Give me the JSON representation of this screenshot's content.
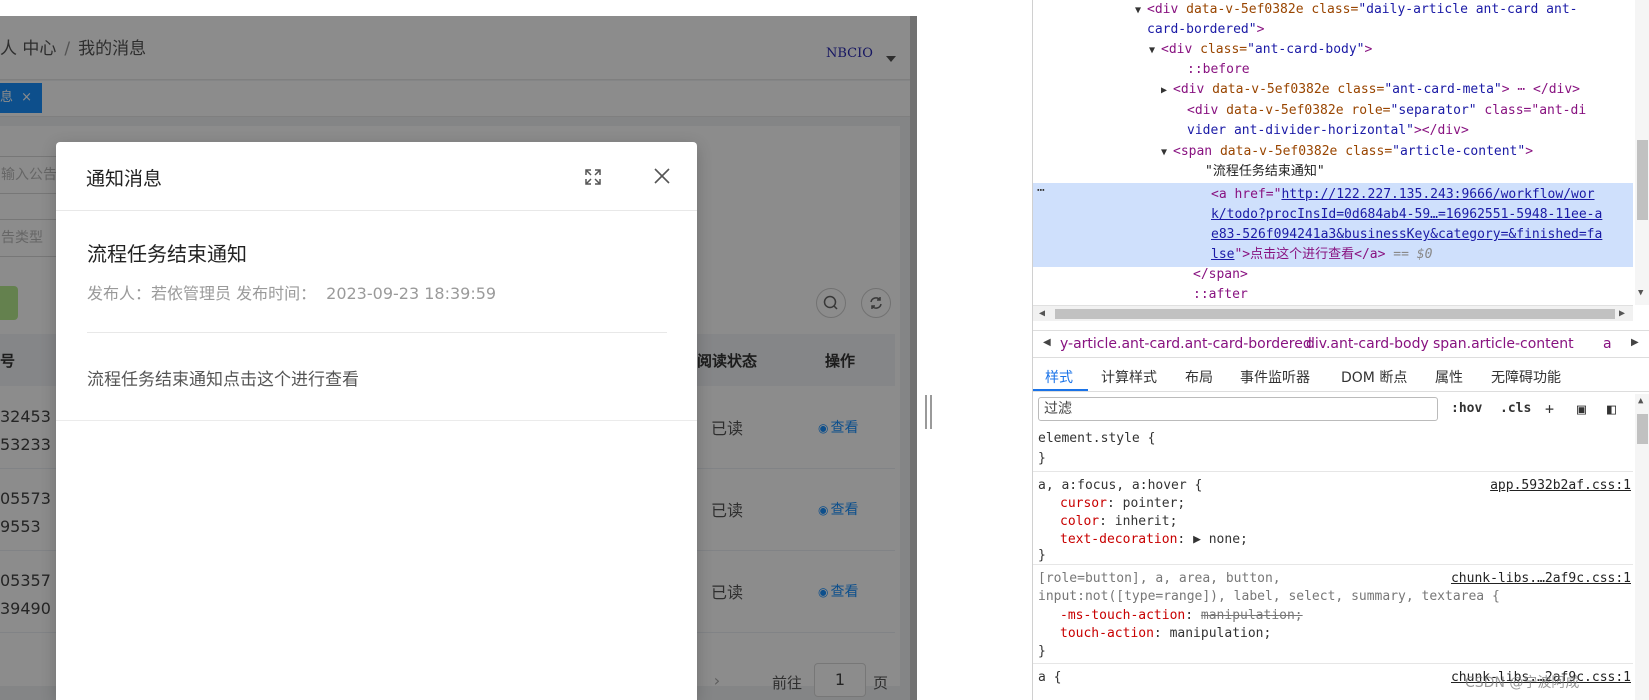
{
  "app": {
    "breadcrumb": {
      "parent": "人 中心",
      "separator": "/",
      "current": "我的消息"
    },
    "user_name": "NBCIO",
    "active_tab": {
      "label": "息",
      "close": "×"
    },
    "search_placeholder": "输入公告",
    "type_placeholder": "告类型",
    "table": {
      "headers": {
        "number": "号",
        "read_status": "阅读状态",
        "action": "操作"
      },
      "rows": [
        {
          "id_line1": "32453",
          "id_line2": "53233",
          "status": "已读",
          "action": "查看"
        },
        {
          "id_line1": "05573",
          "id_line2": "9553",
          "status": "已读",
          "action": "查看"
        },
        {
          "id_line1": "05357",
          "id_line2": "39490",
          "status": "已读",
          "action": "查看"
        }
      ]
    },
    "pager": {
      "next": "›",
      "goto_label": "前往",
      "page_value": "1",
      "unit": "页"
    }
  },
  "modal": {
    "title": "通知消息",
    "message_title": "流程任务结束通知",
    "publisher_label": "发布人：",
    "publisher": "若依管理员",
    "time_label": "发布时间：",
    "time": "2023-09-23 18:39:59",
    "content": "流程任务结束通知点击这个进行查看"
  },
  "devtools": {
    "dom": [
      {
        "indent": 120,
        "tri": "▼",
        "html_tag": "<div",
        "attrs": " data-v-5ef0382e class=",
        "val": "\"daily-article ant-card ant-",
        "tail": ""
      },
      {
        "indent": 120,
        "tri": "",
        "html_tag": "",
        "attrs": "",
        "val": "card-bordered\"",
        "tail": ">"
      },
      {
        "indent": 134,
        "tri": "▼",
        "html_tag": "<div",
        "attrs": " class=",
        "val": "\"ant-card-body\"",
        "tail": ">"
      },
      {
        "indent": 160,
        "tri": "",
        "html_tag": "::before",
        "attrs": "",
        "val": "",
        "tail": ""
      },
      {
        "indent": 146,
        "tri": "▶",
        "html_tag": "<div",
        "attrs": " data-v-5ef0382e class=",
        "val": "\"ant-card-meta\"",
        "tail": "> ⋯ </div>"
      },
      {
        "indent": 160,
        "tri": "",
        "html_tag": "<div",
        "attrs": " data-v-5ef0382e role=",
        "val": "\"separator\"",
        "tail": " class=\"ant-di"
      },
      {
        "indent": 160,
        "tri": "",
        "html_tag": "",
        "attrs": "",
        "val": "vider ant-divider-horizontal\"",
        "tail": "></div>"
      },
      {
        "indent": 146,
        "tri": "▼",
        "html_tag": "<span",
        "attrs": " data-v-5ef0382e class=",
        "val": "\"article-content\"",
        "tail": ">"
      },
      {
        "indent": 178,
        "tri": "",
        "html_tag": "",
        "attrs": "",
        "val": "",
        "tail": "\"流程任务结束通知\""
      }
    ],
    "selected": {
      "line1_prefix": "<a href=\"",
      "line1_link": "http://122.227.135.243:9666/workflow/wor",
      "line2_link": "k/todo?procInsId=0d684ab4-59…=16962551-5948-11ee-a",
      "line3_link": "e83-526f094241a3&businessKey&category=&finished=fa",
      "line4_link": "lse",
      "line4_tail": "\">点击这个进行查看</a>",
      "line4_eq": " == $0",
      "dots": "⋯"
    },
    "dom_after": [
      {
        "indent": 160,
        "text": "</span>",
        "kind": "tag"
      },
      {
        "indent": 160,
        "text": "::after",
        "kind": "pseudo"
      }
    ],
    "crumbs": [
      "y-article.ant-card.ant-card-bordered",
      "div.ant-card-body",
      "span.article-content",
      "a"
    ],
    "tabs": [
      "样式",
      "计算样式",
      "布局",
      "事件监听器",
      "DOM 断点",
      "属性",
      "无障碍功能"
    ],
    "filter_placeholder": "过滤",
    "hov": ":hov",
    "cls": ".cls",
    "rules": [
      {
        "selector": "element.style {",
        "source": "",
        "props": [],
        "close": "}"
      },
      {
        "selector": "a, a:focus, a:hover {",
        "source": "app.5932b2af.css:1",
        "props": [
          {
            "name": "cursor",
            "value": "pointer;",
            "strike": false
          },
          {
            "name": "color",
            "value": "inherit;",
            "strike": false
          },
          {
            "name": "text-decoration",
            "value": "▶ none;",
            "strike": false
          }
        ],
        "close": "}"
      },
      {
        "selector": "[role=button], a, area, button,",
        "selector2": "input:not([type=range]), label, select, summary, textarea {",
        "source": "chunk-libs.…2af9c.css:1",
        "props": [
          {
            "name": "-ms-touch-action",
            "value": "manipulation;",
            "strike": true
          },
          {
            "name": "touch-action",
            "value": "manipulation;",
            "strike": false
          }
        ],
        "close": "}"
      },
      {
        "selector": "a {",
        "source": "chunk-libs.…2af9c.css:1",
        "props": [],
        "close": ""
      }
    ]
  },
  "watermark": "CSDN @宁波阿成"
}
